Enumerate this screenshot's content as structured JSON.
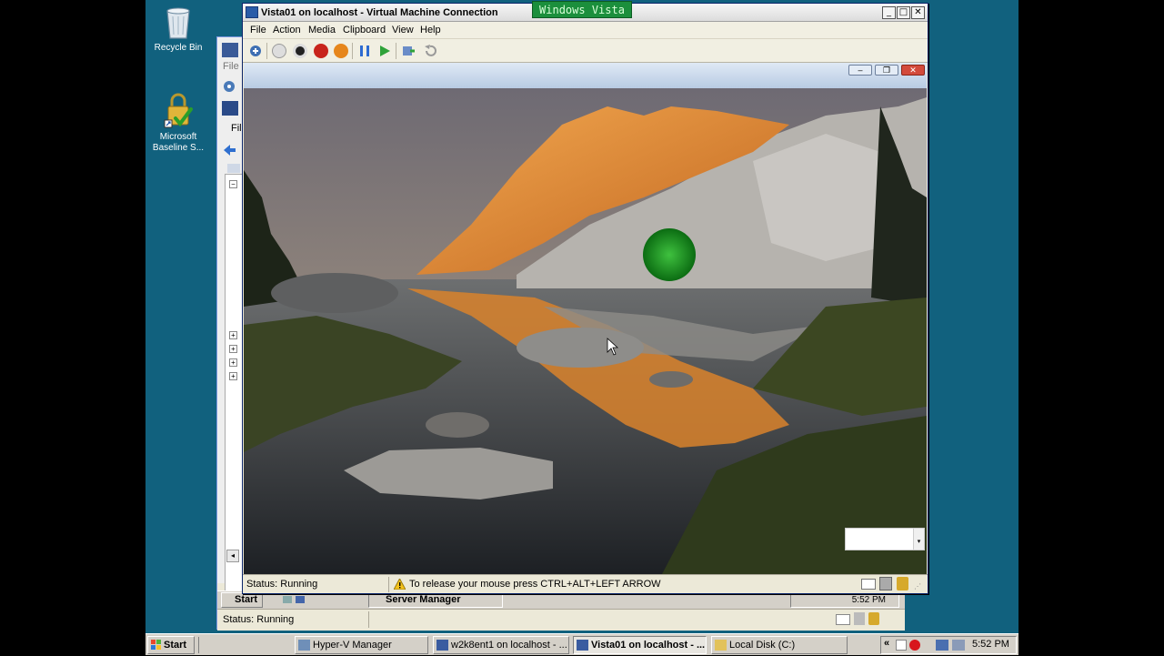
{
  "desktop": {
    "icons": [
      {
        "label": "Recycle Bin"
      },
      {
        "label": "Microsoft Baseline S..."
      }
    ]
  },
  "background_window": {
    "menu_file": "File",
    "menu_file_inner": "Fil",
    "status": "Status: Running",
    "taskbar": {
      "start": "Start",
      "server_manager": "Server Manager",
      "clock": "5:52 PM"
    }
  },
  "vm_window": {
    "title": "Vista01 on localhost - Virtual Machine Connection",
    "os_badge": "Windows Vista",
    "menu": [
      "File",
      "Action",
      "Media",
      "Clipboard",
      "View",
      "Help"
    ],
    "status_left": "Status: Running",
    "status_hint": "To release your mouse press CTRL+ALT+LEFT ARROW"
  },
  "taskbar": {
    "start": "Start",
    "buttons": [
      {
        "label": "Hyper-V Manager"
      },
      {
        "label": "w2k8ent1 on localhost - ..."
      },
      {
        "label": "Vista01 on localhost - ..."
      },
      {
        "label": "Local Disk (C:)"
      }
    ],
    "clock": "5:52 PM",
    "tray_chevron": "«"
  },
  "colors": {
    "desktop": "#11617e",
    "vista_badge": "#1b8f3c",
    "title_text": "#000000"
  }
}
